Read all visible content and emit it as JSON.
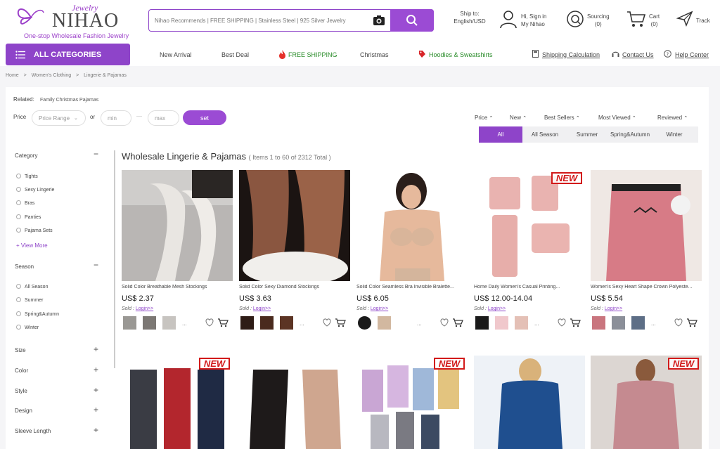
{
  "brand": {
    "script": "Jewelry",
    "name": "NIHAO",
    "tagline": "One-stop Wholesale Fashion Jewelry",
    "accent": "#8e44c9"
  },
  "search": {
    "placeholder": "Nihao Recommends | FREE SHIPPING | Stainless Steel | 925 Silver Jewelry"
  },
  "header": {
    "ship_line1": "Ship to:",
    "ship_line2": "English/USD",
    "account_line1": "Hi, Sign in",
    "account_line2": "My Nihao",
    "sourcing_line1": "Sourcing",
    "sourcing_line2": "(0)",
    "cart_line1": "Cart",
    "cart_line2": "(0)",
    "track": "Track"
  },
  "nav": {
    "all_categories": "ALL CATEGORIES",
    "links": [
      "New Arrival",
      "Best Deal",
      "FREE SHIPPING",
      "Christmas",
      "Hoodies & Sweatshirts"
    ],
    "util": [
      "Shipping Calculation",
      "Contact Us",
      "Help Center"
    ]
  },
  "breadcrumb": [
    "Home",
    "Women's Clothing",
    "Lingerie & Pajamas"
  ],
  "related": {
    "label": "Related:",
    "value": "Family Christmas Pajamas"
  },
  "price_filter": {
    "label": "Price",
    "range": "Price Range",
    "or": "or",
    "min": "min",
    "max": "max",
    "dash": "—",
    "set": "set"
  },
  "sort": [
    "Price",
    "New",
    "Best Sellers",
    "Most Viewed",
    "Reviewed"
  ],
  "season_tabs": [
    "All",
    "All Season",
    "Summer",
    "Spring&Autumn",
    "Winter"
  ],
  "sidebar": {
    "category": {
      "title": "Category",
      "items": [
        "Tights",
        "Sexy Lingerie",
        "Bras",
        "Panties",
        "Pajama Sets"
      ],
      "more": "View More"
    },
    "season": {
      "title": "Season",
      "items": [
        "All Season",
        "Summer",
        "Spring&Autumn",
        "Winter"
      ]
    },
    "collapsed": [
      "Size",
      "Color",
      "Style",
      "Design",
      "Sleeve Length"
    ]
  },
  "listing": {
    "title": "Wholesale Lingerie & Pajamas",
    "count": "( Items 1 to 60 of 2312 Total )"
  },
  "products": [
    {
      "name": "Solid Color Breathable Mesh Stockings",
      "price": "US$ 2.37",
      "sold": "Sold :",
      "login": "Login>>",
      "dots": "..."
    },
    {
      "name": "Solid Color Sexy Diamond Stockings",
      "price": "US$ 3.63",
      "sold": "Sold :",
      "login": "Login>>",
      "dots": "..."
    },
    {
      "name": "Solid Color Seamless Bra Invisible Bralette...",
      "price": "US$ 6.05",
      "sold": "Sold :",
      "login": "Login>>",
      "dots": "..."
    },
    {
      "name": "Home Daily Women's Casual Printing...",
      "price": "US$ 12.00-14.04",
      "sold": "Sold :",
      "login": "Login>>",
      "dots": "...",
      "badge": "NEW"
    },
    {
      "name": "Women's Sexy Heart Shape Crown Polyeste...",
      "price": "US$ 5.54",
      "sold": "Sold :",
      "login": "Login>>",
      "dots": "..."
    }
  ],
  "row2_badges": [
    "NEW",
    "NEW",
    "NEW"
  ]
}
